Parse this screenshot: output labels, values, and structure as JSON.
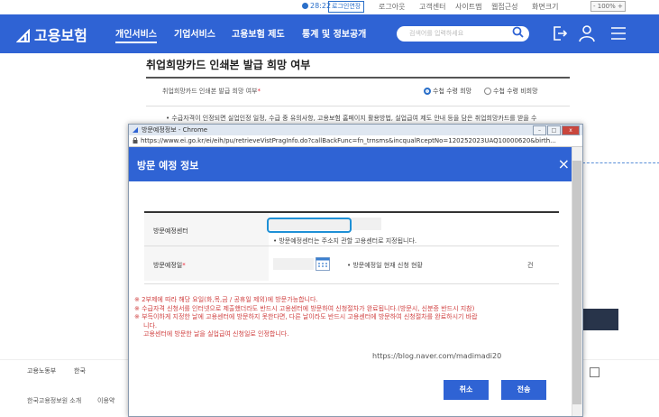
{
  "util_bar": {
    "timer": "28:22",
    "extend_login": "로그인연장",
    "items": [
      "로그아웃",
      "고객센터",
      "사이트맵",
      "웹접근성",
      "화면크기"
    ],
    "zoom": "100%"
  },
  "header": {
    "logo": "고용보험",
    "nav": [
      "개인서비스",
      "기업서비스",
      "고용보험 제도",
      "통계 및 정보공개"
    ],
    "search_placeholder": "검색어를 입력하세요"
  },
  "page": {
    "title": "취업희망카드 인쇄본 발급 희망 여부",
    "field_label": "취업희망카드 인쇄본 발급 희망 여부",
    "required_mark": "*",
    "option_yes": "수첩 수령 희망",
    "option_no": "수첩 수령 비희망",
    "note": "• 수급자격이 인정되면 실업인정 일정, 수급 중 유의사항, 고용보험 홈페이지 활용방법, 실업급여 제도 안내 등을 담은 취업희망카드를 받을 수"
  },
  "footer": {
    "logo1": "고용노동부",
    "logo2": "한국",
    "links": [
      "한국고용정보원 소개",
      "이용약"
    ]
  },
  "popup": {
    "window_title": "방문예정정보 - Chrome",
    "url": "https://www.ei.go.kr/ei/eih/pu/retrieveVistPragInfo.do?callBackFunc=fn_trnsms&incqualRceptNo=120252023UAQ10000620&birth...",
    "title": "방문 예정 정보",
    "close": "×",
    "row1_label": "방문예정센터",
    "row1_hint": "• 방문예정센터는 주소지 관할 고용센터로 지정됩니다.",
    "row2_label": "방문예정일",
    "row2_required": "*",
    "row2_hint": "• 방문예정일 현재 신청 현황",
    "row2_unit": "건",
    "notes": [
      "※ 2부제에 따라 해당 요일(화,목,금 / 공휴일 제외)에 방문가능합니다.",
      "※ 수급자격 신청서를 인터넷으로 제출했더라도 반드시 고용센터에 방문하여 신청절차가 완료됩니다.(방문시, 신분증 반드시 지참)",
      "※ 부득이하게 지정한 날에 고용센터에 방문하지 못한다면, 다른 날이라도 반드시 고용센터에 방문하여 신청절차를 완료하시기 바랍",
      "니다.",
      "고용센터에 방문한 날을 실업급여 신청일로 인정합니다."
    ],
    "watermark": "https://blog.naver.com/madimadi20",
    "cancel": "취소",
    "submit": "전송"
  },
  "colors": {
    "brand_blue": "#2f63d4",
    "required_red": "#e23333",
    "focus_outline": "#1e90d6"
  },
  "icons": [
    "timer-icon",
    "search-icon",
    "login-icon",
    "user-icon",
    "menu-icon",
    "calendar-icon",
    "lock-icon",
    "external-link-icon"
  ]
}
